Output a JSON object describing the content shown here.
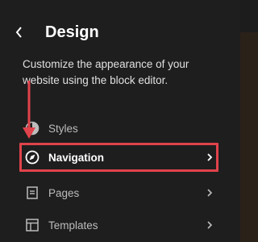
{
  "header": {
    "back_icon": "chevron-left-icon",
    "title": "Design"
  },
  "description": "Customize the appearance of your website using the block editor.",
  "nav": [
    {
      "label": "Styles",
      "icon": "half-circle-icon",
      "has_chevron": false
    },
    {
      "label": "Navigation",
      "icon": "navigation-compass-icon",
      "has_chevron": true,
      "active": true
    },
    {
      "label": "Pages",
      "icon": "page-icon",
      "has_chevron": true
    },
    {
      "label": "Templates",
      "icon": "layout-icon",
      "has_chevron": true
    }
  ],
  "colors": {
    "background": "#1e1e1e",
    "annotation": "#e0434b",
    "text": "#ffffff",
    "muted": "#bcbcbc"
  }
}
